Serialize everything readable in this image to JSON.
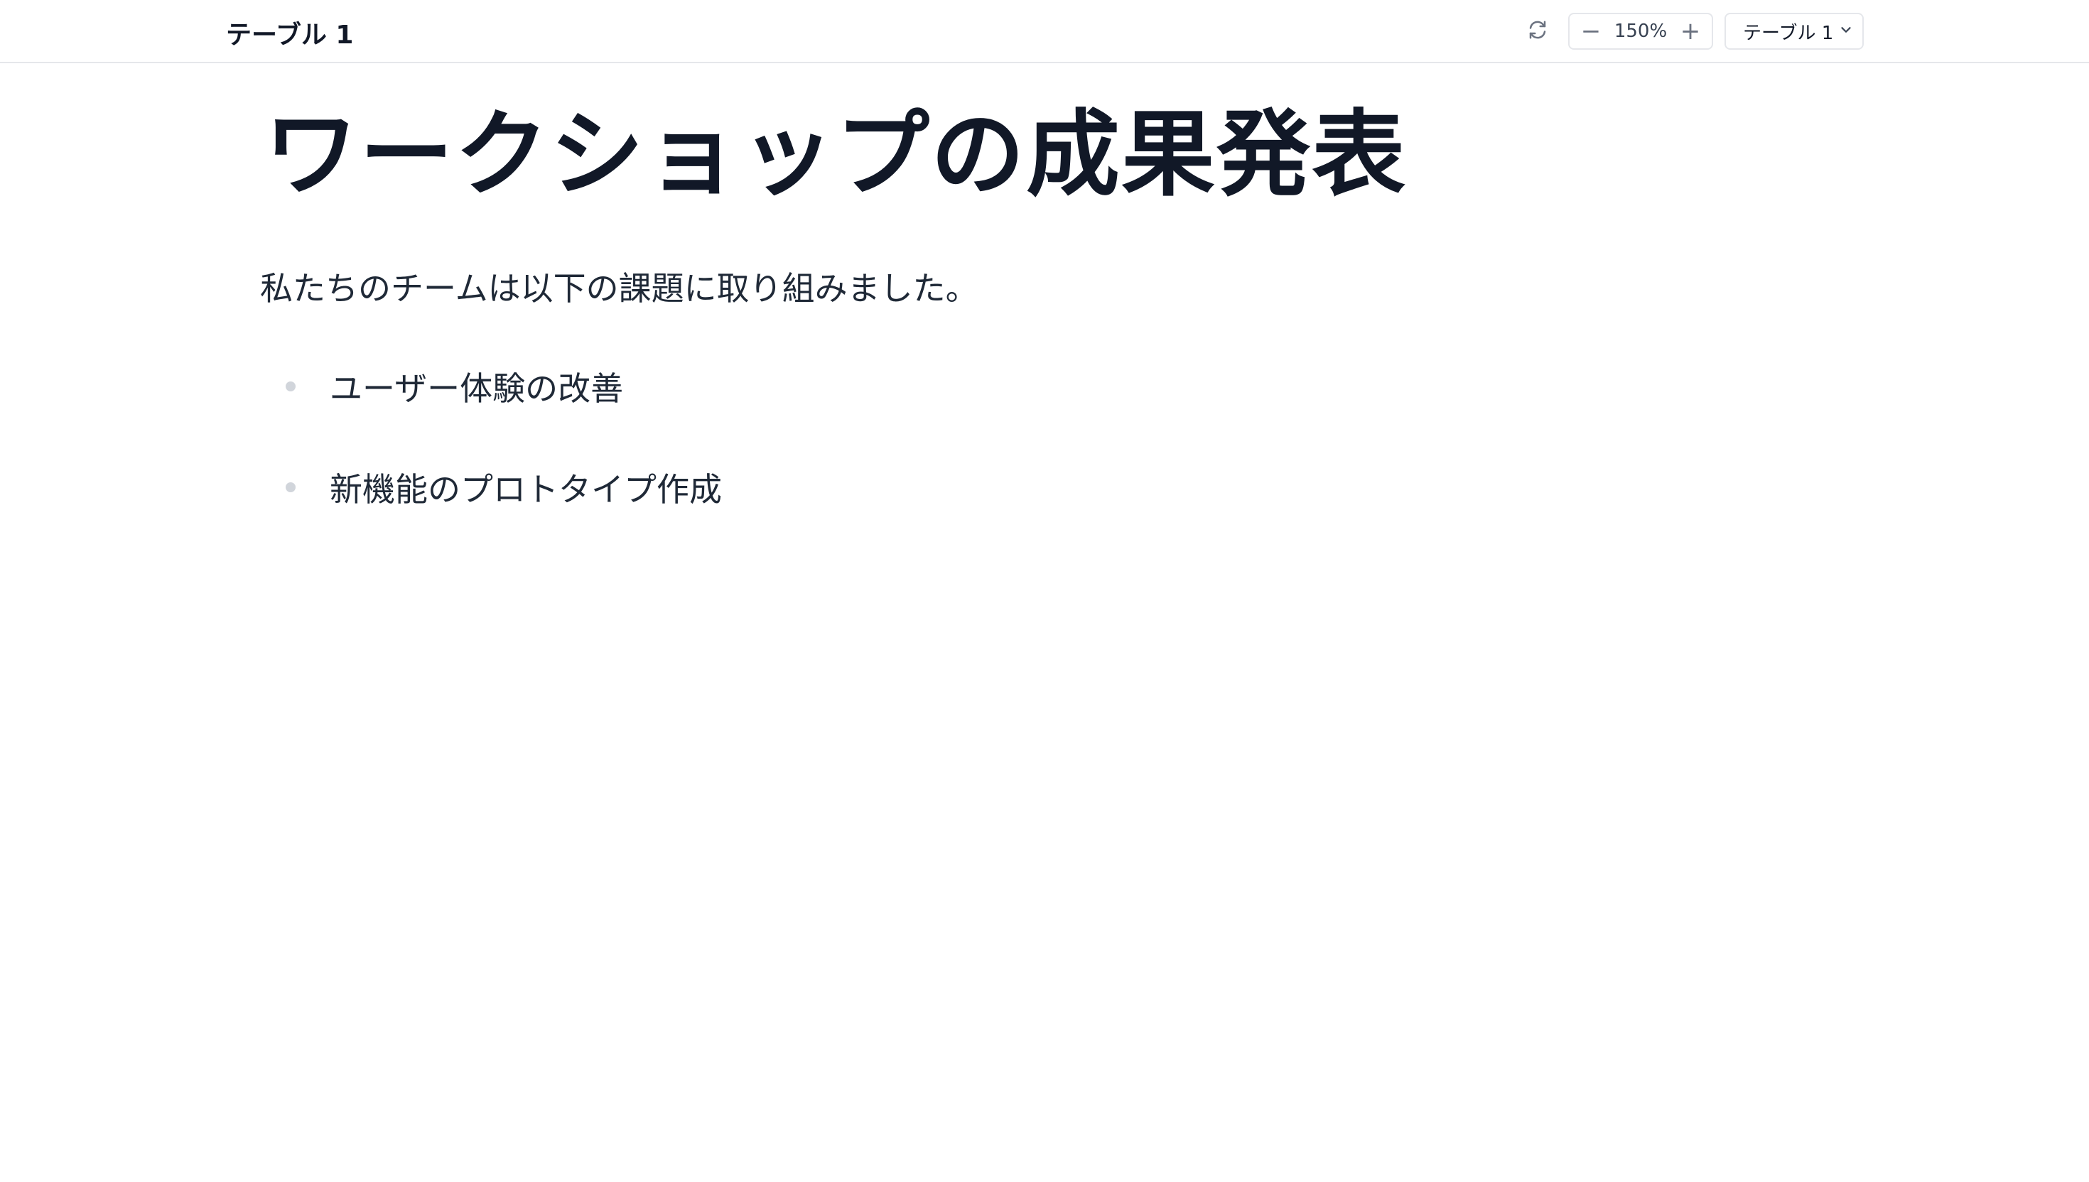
{
  "header": {
    "title": "テーブル 1",
    "zoom": {
      "decrease_label": "−",
      "value": "150%",
      "increase_label": "+"
    },
    "table_select": {
      "selected": "テーブル 1"
    }
  },
  "document": {
    "heading": "ワークショップの成果発表",
    "paragraph": "私たちのチームは以下の課題に取り組みました。",
    "bullets": [
      "ユーザー体験の改善",
      "新機能のプロトタイプ作成"
    ]
  },
  "colors": {
    "text": "#111827",
    "border": "#e5e7eb",
    "bullet": "#d1d5db",
    "icon": "#6b7280"
  },
  "icons": {
    "refresh": "refresh-icon",
    "chevron": "chevron-down-icon"
  }
}
